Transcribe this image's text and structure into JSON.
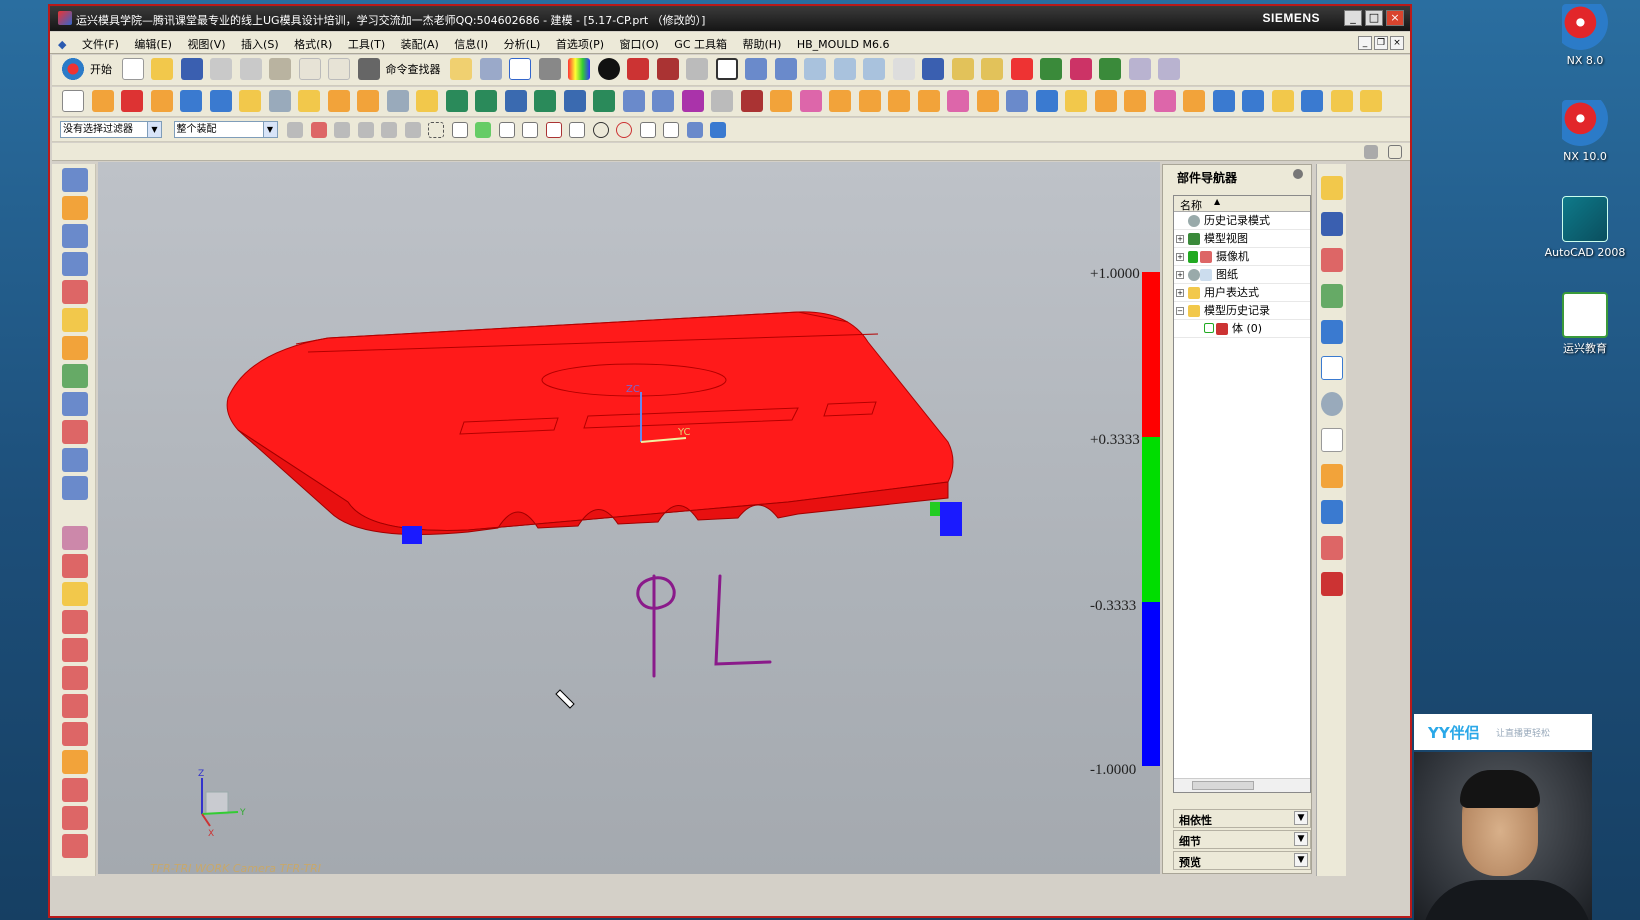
{
  "window": {
    "title": "运兴模具学院—腾讯课堂最专业的线上UG模具设计培训，学习交流加一杰老师QQ:504602686 - 建模 - [5.17-CP.prt （修改的）]",
    "brand": "SIEMENS",
    "buttons": [
      "_",
      "□",
      "×"
    ]
  },
  "menubar": {
    "items": [
      "文件(F)",
      "编辑(E)",
      "视图(V)",
      "插入(S)",
      "格式(R)",
      "工具(T)",
      "装配(A)",
      "信息(I)",
      "分析(L)",
      "首选项(P)",
      "窗口(O)",
      "GC 工具箱",
      "帮助(H)",
      "HB_MOULD M6.6"
    ],
    "mdi_buttons": [
      "_",
      "❐",
      "×"
    ]
  },
  "toolbar1": {
    "start_label": "开始",
    "command_finder_label": "命令查找器"
  },
  "toolbar3": {
    "filter_select": "没有选择过滤器",
    "scope_select": "整个装配"
  },
  "scale": {
    "labels": [
      "+1.0000",
      "+0.3333",
      "-0.3333",
      "-1.0000"
    ],
    "colors": [
      "#ff0000",
      "#00dd00",
      "#0000ff"
    ]
  },
  "viewport": {
    "status_text": "TFR-TRI WORK Camera TFR-TRI",
    "annotation": "PL",
    "annotation_color": "#8a1a8a",
    "part_color": "#ff1a1a",
    "triad_labels": {
      "z": "Z",
      "y": "Y",
      "x": "X"
    },
    "axis_labels": {
      "zc": "ZC",
      "yc": "YC"
    }
  },
  "navigator": {
    "title": "部件导航器",
    "column_name": "名称",
    "items": [
      {
        "label": "历史记录模式",
        "icon": "clock-icon",
        "expand": ""
      },
      {
        "label": "模型视图",
        "icon": "model-views-icon",
        "expand": "+"
      },
      {
        "label": "摄像机",
        "icon": "camera-icon",
        "expand": "+"
      },
      {
        "label": "图纸",
        "icon": "drawing-icon",
        "expand": "+"
      },
      {
        "label": "用户表达式",
        "icon": "folder-icon",
        "expand": "+"
      },
      {
        "label": "模型历史记录",
        "icon": "folder-open-icon",
        "expand": "−"
      },
      {
        "label": "体 (0)",
        "icon": "body-icon",
        "expand": ""
      }
    ],
    "panels": [
      "相依性",
      "细节",
      "预览"
    ]
  },
  "desktop": {
    "icons": [
      {
        "label": "NX 8.0",
        "icon": "nx-icon"
      },
      {
        "label": "NX 10.0",
        "icon": "nx-icon"
      },
      {
        "label": "AutoCAD 2008",
        "icon": "autocad-icon"
      },
      {
        "label": "运兴教育",
        "icon": "education-logo-icon"
      }
    ]
  },
  "yy": {
    "brand": "YY伴侣",
    "slogan": "让直播更轻松"
  }
}
